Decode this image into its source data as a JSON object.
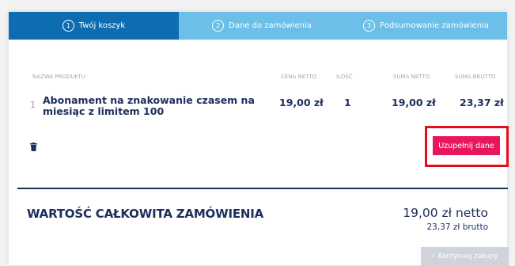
{
  "steps": [
    {
      "num": "1",
      "label": "Twój koszyk"
    },
    {
      "num": "2",
      "label": "Dane do zamówienia"
    },
    {
      "num": "3",
      "label": "Podsumowanie zamówienia"
    }
  ],
  "table": {
    "headers": {
      "name": "NAZWA PRODUKTU",
      "price": "CENA NETTO",
      "qty": "ILOŚĆ",
      "net": "SUMA NETTO",
      "gross": "SUMA BRUTTO"
    },
    "rows": [
      {
        "index": "1",
        "name": "Abonament na znakowanie czasem na miesiąc z limitem 100",
        "price": "19,00 zł",
        "qty": "1",
        "net": "19,00 zł",
        "gross": "23,37 zł"
      }
    ]
  },
  "actions": {
    "complete_label": "Uzupełnij dane",
    "continue_label": "Kontynuuj zakupy",
    "delete_icon": "trash-icon"
  },
  "summary": {
    "label": "WARTOŚĆ CAŁKOWITA ZAMÓWIENIA",
    "net": "19,00 zł netto",
    "gross": "23,37 zł brutto"
  },
  "colors": {
    "step_active": "#0e6cb0",
    "step_inactive": "#6bbfe8",
    "text_primary": "#1d2d5c",
    "button_primary": "#e8175d",
    "highlight": "#e0101e",
    "button_disabled": "#cfd3da"
  }
}
